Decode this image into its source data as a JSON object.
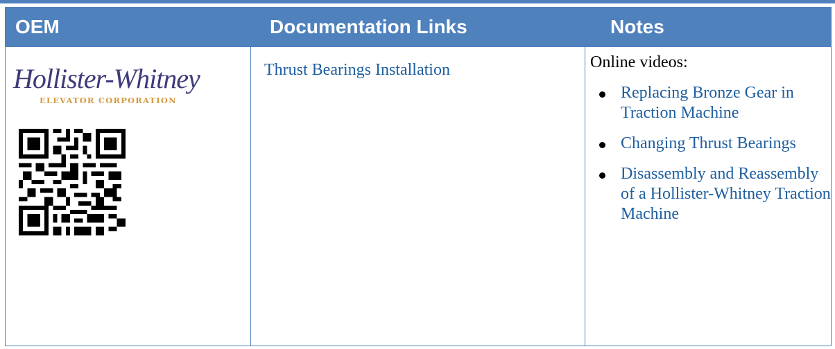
{
  "table": {
    "headers": {
      "oem": "OEM",
      "docs": "Documentation Links",
      "notes": "Notes"
    },
    "row": {
      "logo": {
        "name": "Hollister-Whitney",
        "subtitle": "ELEVATOR CORPORATION"
      },
      "doc_link": "Thrust Bearings Installation",
      "notes_title": "Online videos:",
      "videos": [
        "Replacing Bronze Gear in Traction Machine",
        "Changing Thrust Bearings",
        "Disassembly and Reassembly of a Hollister-Whitney Traction Machine"
      ]
    }
  },
  "colors": {
    "header_bg": "#4f81bd",
    "link": "#1f5fa0",
    "logo_primary": "#3d3b7a",
    "logo_secondary": "#d39a42"
  }
}
